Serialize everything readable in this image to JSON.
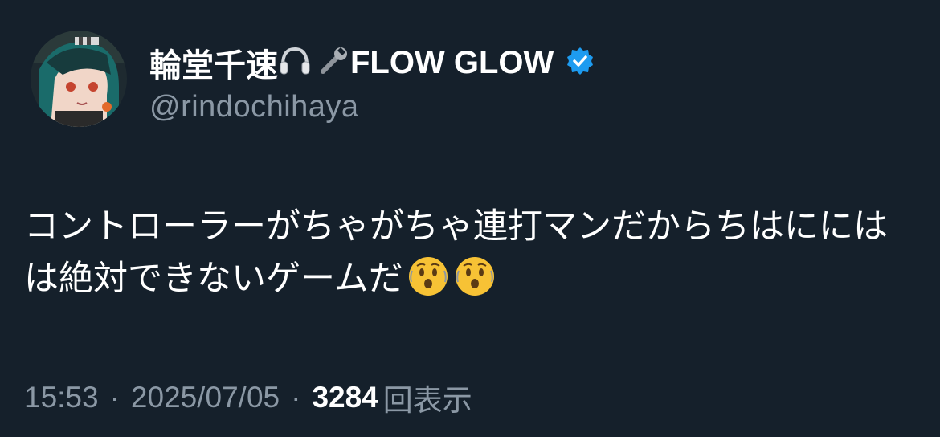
{
  "user": {
    "display_name_prefix": "輪堂千速",
    "display_name_suffix": "FLOW GLOW",
    "handle": "@rindochihaya",
    "name_icons": [
      "headphones-icon",
      "wrench-icon"
    ],
    "verified": true,
    "verified_color": "#1d9bf0"
  },
  "tweet": {
    "line1": "コントローラーがちゃがちゃ連打マンだからちはにには",
    "line2": "は絶対できないゲームだ",
    "trailing_emoji": [
      "hushed-face-emoji",
      "hushed-face-emoji"
    ]
  },
  "meta": {
    "time": "15:53",
    "separator": "·",
    "date": "2025/07/05",
    "view_count": "3284",
    "view_label": "回表示"
  },
  "colors": {
    "background": "#15202b",
    "text": "#ffffff",
    "secondary": "#8b98a5"
  }
}
